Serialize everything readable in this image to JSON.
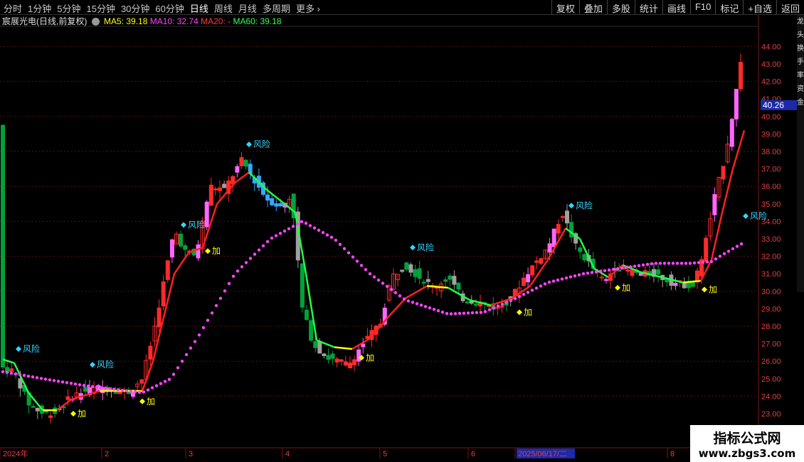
{
  "toolbar": {
    "periods": [
      "分时",
      "1分钟",
      "5分钟",
      "15分钟",
      "30分钟",
      "60分钟",
      "日线",
      "周线",
      "月线",
      "多周期",
      "更多"
    ],
    "active_period": "日线",
    "right_buttons": [
      "复权",
      "叠加",
      "多股",
      "统计",
      "画线",
      "F10",
      "标记",
      "+自选",
      "返回"
    ]
  },
  "info": {
    "stock": "宸展光电(日线,前复权)",
    "ma5": "MA5: 39.18",
    "ma10": "MA10: 32.74",
    "ma20": "MA20: -",
    "ma60": "MA60: 39.18"
  },
  "price_tag": "40.26",
  "chart_data": {
    "type": "candlestick",
    "y_ticks": [
      "23.00",
      "24.00",
      "25.00",
      "26.00",
      "27.00",
      "28.00",
      "29.00",
      "30.00",
      "31.00",
      "32.00",
      "33.00",
      "34.00",
      "35.00",
      "36.00",
      "37.00",
      "38.00",
      "39.00",
      "40.00",
      "41.00",
      "42.00",
      "43.00",
      "44.00"
    ],
    "x_labels": [
      "2024年",
      "2",
      "3",
      "4",
      "5",
      "6",
      "2025/06/17/二",
      "8"
    ],
    "signals": {
      "risk": "风险",
      "add": "加"
    },
    "colors": {
      "up": "#ff2a2a",
      "down": "#00a23a",
      "ma_up": "#ff2020",
      "ma_flat": "#ffff00",
      "ma_down": "#22ff44",
      "ma60": "#ff44ff",
      "risk": "#33d6ff",
      "add": "#ffff00"
    }
  },
  "watermark": {
    "line1": "指标公式网",
    "line2": "www.zbgs3.com"
  },
  "side_text": "龙头换手率资金"
}
